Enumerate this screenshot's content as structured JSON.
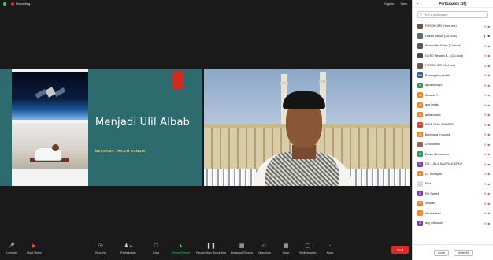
{
  "topbar": {
    "recording_label": "Recording...",
    "sign_in": "Sign in",
    "view": "View"
  },
  "slide": {
    "title": "Menjadi Ulil Albab",
    "subtitle": "BERSAMA : HASIM DANURI"
  },
  "toolbar": {
    "items": [
      "Unmute",
      "Start Video",
      "Security",
      "Participants",
      "Chat",
      "Share Screen",
      "Pause/Stop Recording",
      "Breakout Rooms",
      "Reactions",
      "Apps",
      "Whiteboards",
      "More"
    ],
    "participants_count": "38",
    "end": "End"
  },
  "panel": {
    "title": "Participants (38)",
    "search_placeholder": "Find a participant",
    "invite": "Invite",
    "mute_all": "Mute All",
    "participants": [
      {
        "name": "FOSDM IPB (Host, me)",
        "color": "#6b5a4a",
        "initial": "",
        "mic": "off",
        "cam": "off"
      },
      {
        "name": "Hasim Danuri (Co-host)",
        "color": "#5d6b7a",
        "initial": "",
        "mic": "on",
        "cam": "on"
      },
      {
        "name": "Aminuddin Saleh (Co-host)",
        "color": "#5a5a5a",
        "initial": "",
        "mic": "off",
        "cam": "off"
      },
      {
        "name": "DUSD Newath B... (Co-host)",
        "color": "#4a4a4a",
        "initial": "",
        "mic": "off",
        "cam": "off"
      },
      {
        "name": "FOSDM IPB (Co-host)",
        "color": "#6b5a4a",
        "initial": "",
        "mic": "off",
        "cam": "off"
      },
      {
        "name": "Badang hery fusfri",
        "color": "#2a5e8c",
        "initial": "BH",
        "mic": "off",
        "cam": "off"
      },
      {
        "name": "agus sofdiyo",
        "color": "#2e9a5a",
        "initial": "A",
        "mic": "off",
        "cam": "off"
      },
      {
        "name": "Amarut R",
        "color": "#e8892b",
        "initial": "A",
        "mic": "off",
        "cam": "off"
      },
      {
        "name": "arie lestari",
        "color": "#e8892b",
        "initial": "A",
        "mic": "off",
        "cam": "off"
      },
      {
        "name": "anita rawati",
        "color": "#e8892b",
        "initial": "A",
        "mic": "off",
        "cam": "off"
      },
      {
        "name": "AGIB ONO SAMIDIO",
        "color": "#d6412e",
        "initial": "A",
        "mic": "off",
        "cam": "off"
      },
      {
        "name": "Bambang Irunzara",
        "color": "#e8892b",
        "initial": "B",
        "mic": "off",
        "cam": "off"
      },
      {
        "name": "Deoi wardil",
        "color": "#8a6a55",
        "initial": "",
        "mic": "off",
        "cam": "off"
      },
      {
        "name": "Djoko Sumarsono",
        "color": "#2e9a5a",
        "initial": "D",
        "mic": "off",
        "cam": "off"
      },
      {
        "name": "DR. LAILA NAZIRAH SFAIP",
        "color": "#7a3fb0",
        "initial": "D",
        "mic": "off",
        "cam": "off"
      },
      {
        "name": "Dr. Rohayati",
        "color": "#e8892b",
        "initial": "D",
        "mic": "off",
        "cam": "off"
      },
      {
        "name": "Elsa",
        "color": "#d8d8d8",
        "initial": "E",
        "mic": "off",
        "cam": "off"
      },
      {
        "name": "Elli Sweeti",
        "color": "#7a3fb0",
        "initial": "E",
        "mic": "off",
        "cam": "off"
      },
      {
        "name": "hasnah",
        "color": "#e8892b",
        "initial": "H",
        "mic": "off",
        "cam": "off"
      },
      {
        "name": "Ida Nadirah",
        "color": "#e8892b",
        "initial": "I",
        "mic": "off",
        "cam": "off"
      },
      {
        "name": "ady wibowoh",
        "color": "#7a3fb0",
        "initial": "A",
        "mic": "off",
        "cam": "off"
      }
    ]
  }
}
